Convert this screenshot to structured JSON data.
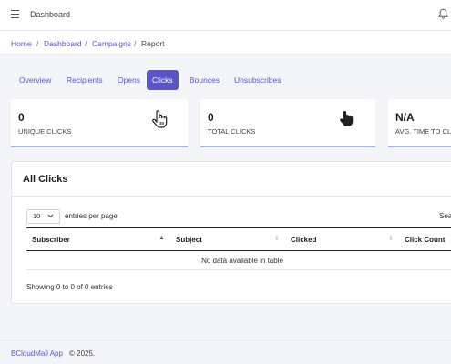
{
  "header": {
    "title": "Dashboard"
  },
  "breadcrumb": [
    {
      "label": "Home"
    },
    {
      "label": "Dashboard"
    },
    {
      "label": "Campaigns"
    },
    {
      "label": "Report"
    }
  ],
  "breadcrumb_separator": "/",
  "tabs": [
    {
      "label": "Overview"
    },
    {
      "label": "Recipients"
    },
    {
      "label": "Opens"
    },
    {
      "label": "Clicks",
      "active": true
    },
    {
      "label": "Bounces"
    },
    {
      "label": "Unsubscribes"
    }
  ],
  "stats": [
    {
      "value": "0",
      "label": "UNIQUE CLICKS",
      "icon": "hand-pointer-outline-icon"
    },
    {
      "value": "0",
      "label": "TOTAL CLICKS",
      "icon": "hand-pointer-solid-icon"
    },
    {
      "value": "N/A",
      "label": "AVG. TIME TO CL"
    }
  ],
  "panel": {
    "title": "All Clicks",
    "page_size": "10",
    "entries_per_page_label": "entries per page",
    "search_label": "Sea",
    "columns": [
      "Subscriber",
      "Subject",
      "Clicked",
      "Click Count"
    ],
    "empty_message": "No data available in table",
    "info": "Showing 0 to 0 of 0 entries"
  },
  "footer": {
    "brand": "BCloudMail App",
    "copyright": "© 2025."
  },
  "colors": {
    "accent": "#5a55c9",
    "card_underline": "#a9b9ec"
  }
}
